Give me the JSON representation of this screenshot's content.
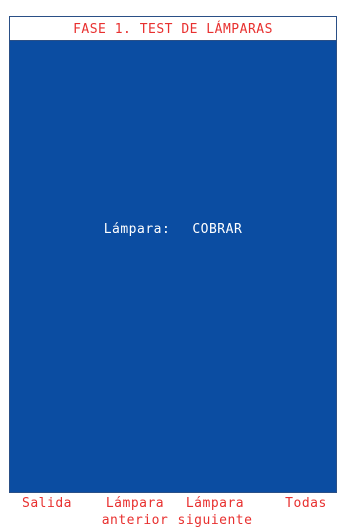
{
  "header": {
    "title": "FASE 1. TEST DE LÁMPARAS"
  },
  "main": {
    "lamp_label": "Lámpara:",
    "lamp_value": "COBRAR"
  },
  "softkeys": [
    {
      "line1": "Salida",
      "line2": ""
    },
    {
      "line1": "Lámpara",
      "line2": "anterior"
    },
    {
      "line1": "Lámpara",
      "line2": "siguiente"
    },
    {
      "line1": "Todas",
      "line2": ""
    }
  ],
  "colors": {
    "screen_background": "#0b4da2",
    "title_text": "#e8302f",
    "softkey_text": "#e8302f",
    "body_text": "#ffffff"
  }
}
